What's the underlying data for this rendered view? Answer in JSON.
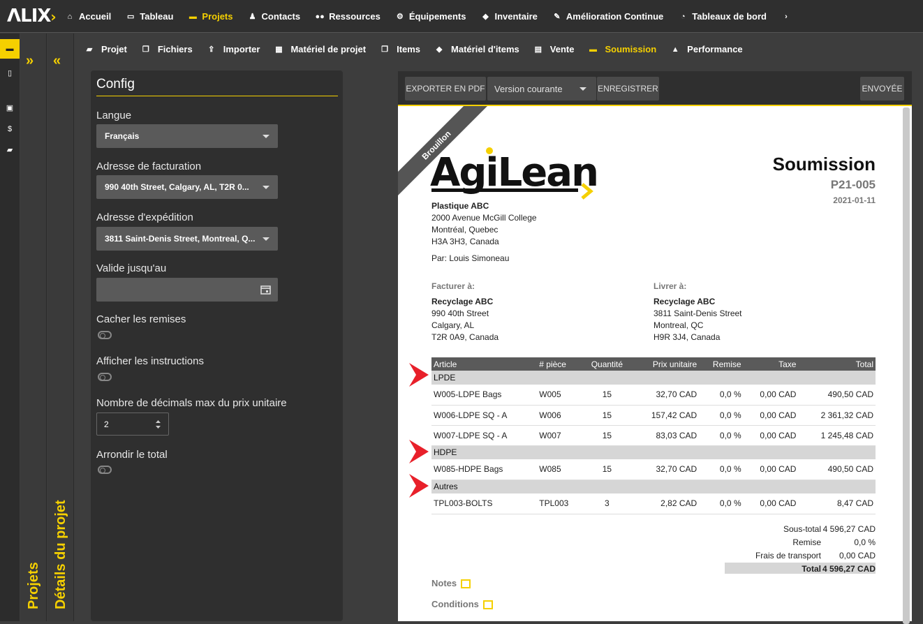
{
  "app": {
    "logo": "ΛLIX",
    "logo_accent": "›"
  },
  "topnav": [
    {
      "label": "Accueil",
      "icon": "home-icon",
      "glyph": "⌂"
    },
    {
      "label": "Tableau",
      "icon": "monitor-icon",
      "glyph": "▭"
    },
    {
      "label": "Projets",
      "icon": "folder-icon",
      "glyph": "▬",
      "active": true
    },
    {
      "label": "Contacts",
      "icon": "person-icon",
      "glyph": "♟"
    },
    {
      "label": "Ressources",
      "icon": "users-icon",
      "glyph": "●●"
    },
    {
      "label": "Équipements",
      "icon": "cogs-icon",
      "glyph": "⚙"
    },
    {
      "label": "Inventaire",
      "icon": "cubes-icon",
      "glyph": "◆"
    },
    {
      "label": "Amélioration Continue",
      "icon": "magic-icon",
      "glyph": "✎"
    },
    {
      "label": "Tableaux de bord",
      "icon": "gauge-icon",
      "glyph": "◔"
    },
    {
      "label": "",
      "icon": "chevron-right-icon",
      "glyph": "›"
    }
  ],
  "subnav": [
    {
      "label": "Projet",
      "icon": "car-icon",
      "glyph": "▰"
    },
    {
      "label": "Fichiers",
      "icon": "copy-icon",
      "glyph": "❐"
    },
    {
      "label": "Importer",
      "icon": "upload-icon",
      "glyph": "⇪"
    },
    {
      "label": "Matériel de projet",
      "icon": "table-icon",
      "glyph": "▦"
    },
    {
      "label": "Items",
      "icon": "square-icon",
      "glyph": "❒"
    },
    {
      "label": "Matériel d'items",
      "icon": "cubes-icon",
      "glyph": "◆"
    },
    {
      "label": "Vente",
      "icon": "card-icon",
      "glyph": "▤"
    },
    {
      "label": "Soumission",
      "icon": "card-icon",
      "glyph": "▬",
      "active": true
    },
    {
      "label": "Performance",
      "icon": "chart-icon",
      "glyph": "▲"
    }
  ],
  "rail": [
    {
      "icon": "folder-icon",
      "glyph": "▬",
      "active": true
    },
    {
      "icon": "file-icon",
      "glyph": "▯"
    },
    {
      "icon": "briefcase-icon",
      "glyph": "▣"
    },
    {
      "icon": "dollar-icon",
      "glyph": "$"
    },
    {
      "icon": "truck-icon",
      "glyph": "▰"
    }
  ],
  "panels": {
    "projects": "Projets",
    "details": "Détails du projet",
    "expand_glyph": "»",
    "collapse_glyph": "«"
  },
  "config": {
    "title": "Config",
    "language_label": "Langue",
    "language_value": "Français",
    "billing_label": "Adresse de facturation",
    "billing_value": "990 40th Street, Calgary, AL, T2R 0...",
    "shipping_label": "Adresse d'expédition",
    "shipping_value": "3811 Saint-Denis Street, Montreal, Q...",
    "valid_label": "Valide jusqu'au",
    "hide_discounts_label": "Cacher les remises",
    "show_instructions_label": "Afficher les instructions",
    "decimals_label": "Nombre de décimals max du prix unitaire",
    "decimals_value": "2",
    "round_label": "Arrondir le total"
  },
  "toolbar": {
    "export": "EXPORTER EN PDF",
    "version": "Version courante",
    "save": "ENREGISTRER",
    "sent": "ENVOYÉE"
  },
  "doc": {
    "ribbon": "Brouillon",
    "brand": "AgiLean",
    "title": "Soumission",
    "number": "P21-005",
    "date": "2021-01-11",
    "company": "Plastique ABC",
    "addr1": "2000 Avenue McGill College",
    "addr2": "Montréal, Quebec",
    "addr3": "H3A 3H3, Canada",
    "by": "Par: Louis Simoneau",
    "bill_to": {
      "label": "Facturer à:",
      "name": "Recyclage ABC",
      "l1": "990 40th Street",
      "l2": "Calgary, AL",
      "l3": "T2R 0A9, Canada"
    },
    "ship_to": {
      "label": "Livrer à:",
      "name": "Recyclage ABC",
      "l1": "3811 Saint-Denis Street",
      "l2": "Montreal, QC",
      "l3": "H9R 3J4, Canada"
    },
    "columns": [
      "Article",
      "# pièce",
      "Quantité",
      "Prix unitaire",
      "Remise",
      "Taxe",
      "Total"
    ],
    "groups": [
      {
        "name": "LPDE",
        "rows": [
          {
            "article": "W005-LDPE Bags",
            "piece": "W005",
            "qty": "15",
            "price": "32,70 CAD",
            "disc": "0,0  %",
            "tax": "0,00 CAD",
            "total": "490,50 CAD"
          },
          {
            "article": "W006-LDPE SQ - A",
            "piece": "W006",
            "qty": "15",
            "price": "157,42 CAD",
            "disc": "0,0  %",
            "tax": "0,00 CAD",
            "total": "2 361,32 CAD"
          },
          {
            "article": "W007-LDPE SQ - A",
            "piece": "W007",
            "qty": "15",
            "price": "83,03 CAD",
            "disc": "0,0  %",
            "tax": "0,00 CAD",
            "total": "1 245,48 CAD"
          }
        ]
      },
      {
        "name": "HDPE",
        "rows": [
          {
            "article": "W085-HDPE Bags",
            "piece": "W085",
            "qty": "15",
            "price": "32,70 CAD",
            "disc": "0,0  %",
            "tax": "0,00 CAD",
            "total": "490,50 CAD"
          }
        ]
      },
      {
        "name": "Autres",
        "rows": [
          {
            "article": "TPL003-BOLTS",
            "piece": "TPL003",
            "qty": "3",
            "price": "2,82 CAD",
            "disc": "0,0  %",
            "tax": "0,00 CAD",
            "total": "8,47 CAD"
          }
        ]
      }
    ],
    "totals": {
      "subtotal_label": "Sous-total",
      "subtotal": "4 596,27 CAD",
      "discount_label": "Remise",
      "discount": "0,0  %",
      "shipping_label": "Frais de transport",
      "shipping": "0,00 CAD",
      "total_label": "Total",
      "total": "4 596,27 CAD"
    },
    "notes": "Notes",
    "conditions": "Conditions"
  },
  "colors": {
    "accent": "#f5d000",
    "marker": "#e8202a"
  }
}
